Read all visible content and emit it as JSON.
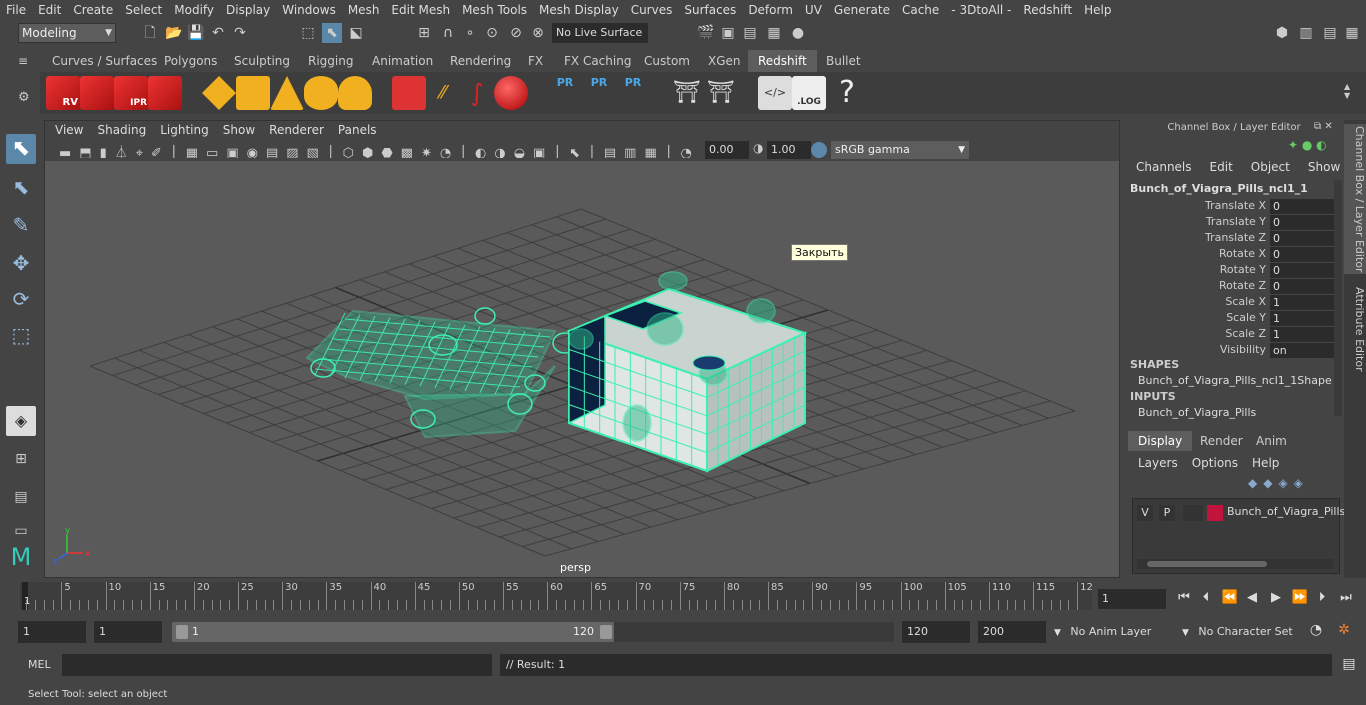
{
  "menubar": [
    "File",
    "Edit",
    "Create",
    "Select",
    "Modify",
    "Display",
    "Windows",
    "Mesh",
    "Edit Mesh",
    "Mesh Tools",
    "Mesh Display",
    "Curves",
    "Surfaces",
    "Deform",
    "UV",
    "Generate",
    "Cache",
    "- 3DtoAll -",
    "Redshift",
    "Help"
  ],
  "status": {
    "mode": "Modeling",
    "live_surface": "No Live Surface"
  },
  "shelf_tabs": [
    "Curves / Surfaces",
    "Polygons",
    "Sculpting",
    "Rigging",
    "Animation",
    "Rendering",
    "FX",
    "FX Caching",
    "Custom",
    "XGen",
    "Redshift",
    "Bullet"
  ],
  "shelf_active": "Redshift",
  "shelf_labels": {
    "rv": "RV",
    "ipr": "IPR",
    "pr1": "PR",
    "pr2": "PR",
    "pr3": "PR",
    "log": ".LOG",
    "help": "?"
  },
  "viewport": {
    "menu": [
      "View",
      "Shading",
      "Lighting",
      "Show",
      "Renderer",
      "Panels"
    ],
    "exposure": "0.00",
    "gamma_value": "1.00",
    "color_space": "sRGB gamma",
    "camera": "persp",
    "tooltip": "Закрыть",
    "axis": {
      "x": "x",
      "y": "y",
      "z": "z"
    }
  },
  "channelbox": {
    "title": "Channel Box / Layer Editor",
    "menu": [
      "Channels",
      "Edit",
      "Object",
      "Show"
    ],
    "object": "Bunch_of_Viagra_Pills_ncl1_1",
    "attributes": [
      {
        "label": "Translate X",
        "value": "0"
      },
      {
        "label": "Translate Y",
        "value": "0"
      },
      {
        "label": "Translate Z",
        "value": "0"
      },
      {
        "label": "Rotate X",
        "value": "0"
      },
      {
        "label": "Rotate Y",
        "value": "0"
      },
      {
        "label": "Rotate Z",
        "value": "0"
      },
      {
        "label": "Scale X",
        "value": "1"
      },
      {
        "label": "Scale Y",
        "value": "1"
      },
      {
        "label": "Scale Z",
        "value": "1"
      },
      {
        "label": "Visibility",
        "value": "on"
      }
    ],
    "shapes_header": "SHAPES",
    "shape": "Bunch_of_Viagra_Pills_ncl1_1Shape",
    "inputs_header": "INPUTS",
    "input": "Bunch_of_Viagra_Pills",
    "display_tabs": [
      "Display",
      "Render",
      "Anim"
    ],
    "layer_menu": [
      "Layers",
      "Options",
      "Help"
    ],
    "layer": {
      "v": "V",
      "p": "P",
      "name": "Bunch_of_Viagra_Pills",
      "color": "#c0143c"
    }
  },
  "side_tabs": [
    "Channel Box / Layer Editor",
    "Attribute Editor"
  ],
  "timeline": {
    "ticks": [
      "5",
      "10",
      "15",
      "20",
      "25",
      "30",
      "35",
      "40",
      "45",
      "50",
      "55",
      "60",
      "65",
      "70",
      "75",
      "80",
      "85",
      "90",
      "95",
      "100",
      "105",
      "110",
      "115",
      "12"
    ],
    "start_label": "1",
    "current_frame": "1"
  },
  "range": {
    "start": "1",
    "playback_start": "1",
    "inner_start": "1",
    "inner_end": "120",
    "playback_end": "120",
    "end": "200",
    "anim_layer": "No Anim Layer",
    "char_set": "No Character Set"
  },
  "command": {
    "lang": "MEL",
    "result": "// Result: 1"
  },
  "help_line": "Select Tool: select an object",
  "colors": {
    "wire": "#3cf0b0",
    "viewport_bg": "#5a5a5a",
    "ui_bg": "#444444",
    "field_bg": "#2b2b2b"
  }
}
